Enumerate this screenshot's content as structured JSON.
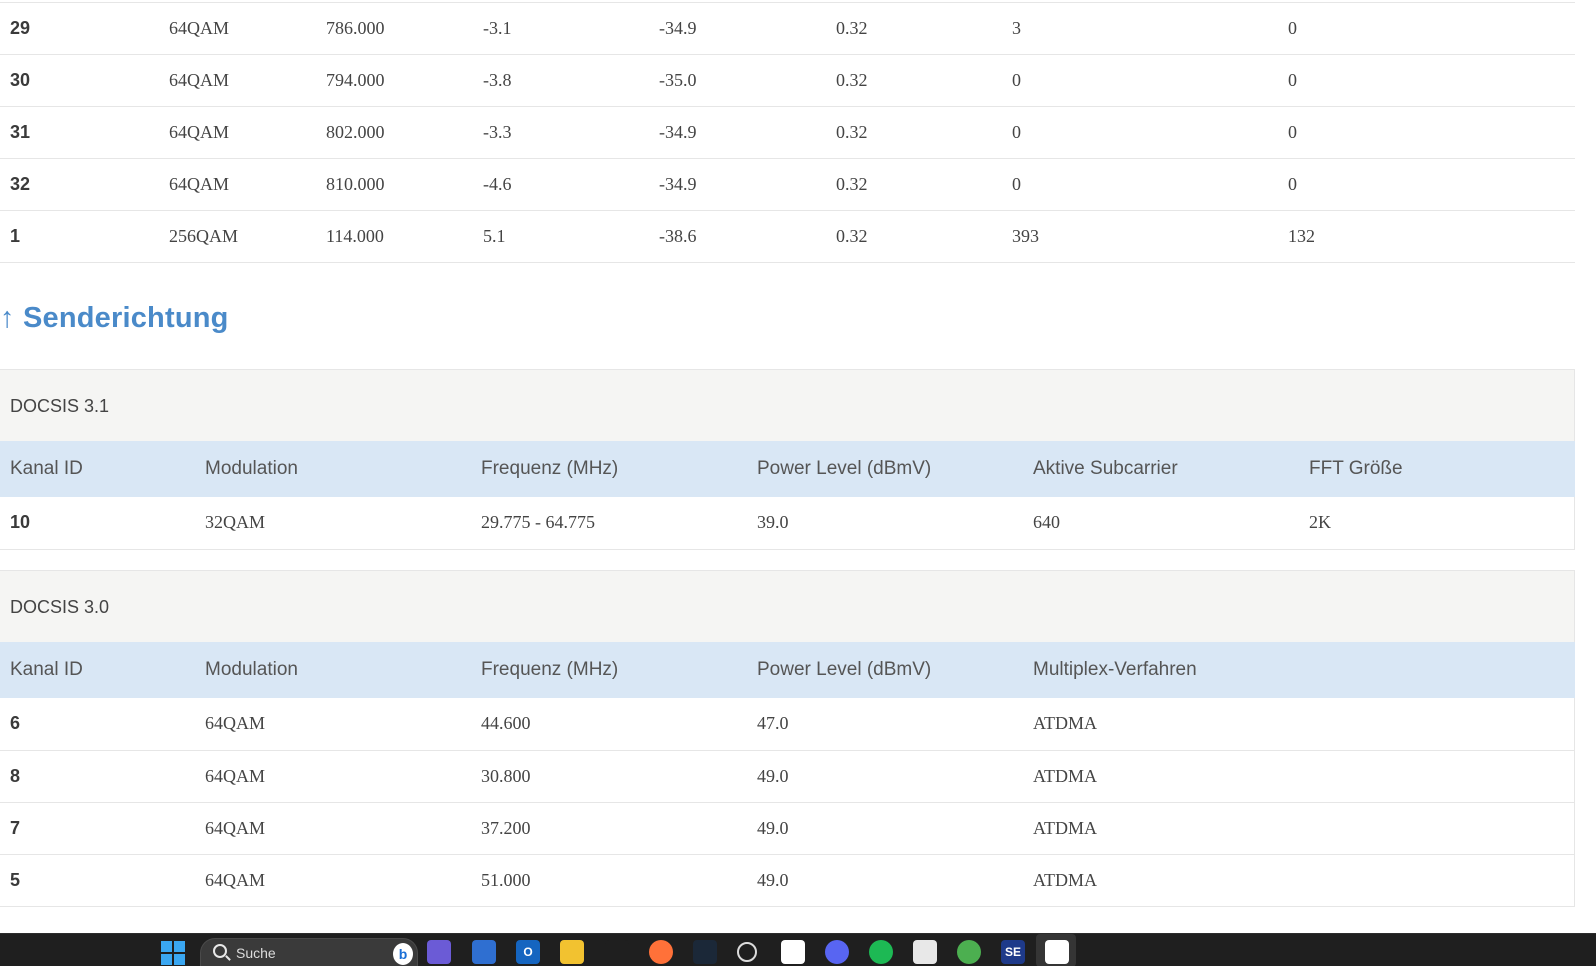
{
  "downstream_rows": [
    [
      "29",
      "64QAM",
      "786.000",
      "-3.1",
      "-34.9",
      "0.32",
      "3",
      "0"
    ],
    [
      "30",
      "64QAM",
      "794.000",
      "-3.8",
      "-35.0",
      "0.32",
      "0",
      "0"
    ],
    [
      "31",
      "64QAM",
      "802.000",
      "-3.3",
      "-34.9",
      "0.32",
      "0",
      "0"
    ],
    [
      "32",
      "64QAM",
      "810.000",
      "-4.6",
      "-34.9",
      "0.32",
      "0",
      "0"
    ],
    [
      "1",
      "256QAM",
      "114.000",
      "5.1",
      "-38.6",
      "0.32",
      "393",
      "132"
    ]
  ],
  "upstream": {
    "title": "↑ Senderichtung",
    "docsis31": {
      "caption": "DOCSIS 3.1",
      "headers": [
        "Kanal ID",
        "Modulation",
        "Frequenz (MHz)",
        "Power Level (dBmV)",
        "Aktive Subcarrier",
        "FFT Größe"
      ],
      "rows": [
        [
          "10",
          "32QAM",
          "29.775 - 64.775",
          "39.0",
          "640",
          "2K"
        ]
      ]
    },
    "docsis30": {
      "caption": "DOCSIS 3.0",
      "headers": [
        "Kanal ID",
        "Modulation",
        "Frequenz (MHz)",
        "Power Level (dBmV)",
        "Multiplex-Verfahren"
      ],
      "rows": [
        [
          "6",
          "64QAM",
          "44.600",
          "47.0",
          "ATDMA"
        ],
        [
          "8",
          "64QAM",
          "30.800",
          "49.0",
          "ATDMA"
        ],
        [
          "7",
          "64QAM",
          "37.200",
          "49.0",
          "ATDMA"
        ],
        [
          "5",
          "64QAM",
          "51.000",
          "49.0",
          "ATDMA"
        ]
      ]
    }
  },
  "taskbar": {
    "search_placeholder": "Suche",
    "apps": [
      "bing-chat",
      "teams",
      "store",
      "outlook",
      "file-explorer",
      "nvidia",
      "firefox",
      "steam",
      "cortana",
      "xbox",
      "discord",
      "spotify",
      "calculator",
      "globe",
      "se-app",
      "snipping-tool"
    ],
    "colors": {
      "start": "#3aa7f2",
      "taskbar_bg": "#1f1f1f",
      "accent_title": "#4a8ac9",
      "header_row_bg": "#d9e7f5"
    }
  }
}
